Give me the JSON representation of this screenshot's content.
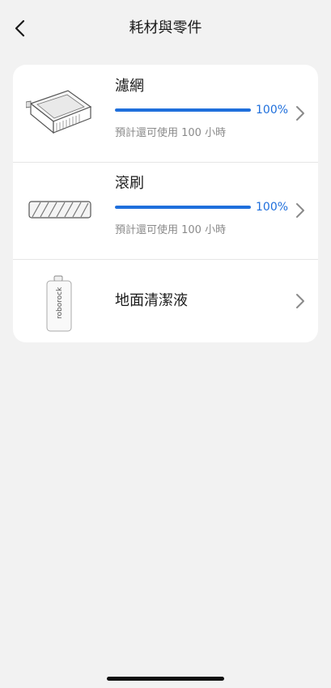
{
  "header": {
    "title": "耗材與零件",
    "back_icon": "chevron-left-icon"
  },
  "consumables": [
    {
      "name": "濾網",
      "icon": "filter-icon",
      "progress_percent": 100,
      "percent_label": "100%",
      "remaining_text": "預計還可使用 100 小時"
    },
    {
      "name": "滾刷",
      "icon": "roller-brush-icon",
      "progress_percent": 100,
      "percent_label": "100%",
      "remaining_text": "預計還可使用 100 小時"
    },
    {
      "name": "地面清潔液",
      "icon": "cleaning-solution-bottle-icon",
      "bottle_brand": "roborock"
    }
  ],
  "colors": {
    "accent": "#1f6fdc",
    "background": "#f2f2f2",
    "card": "#ffffff",
    "secondary_text": "#8a8a8a"
  }
}
